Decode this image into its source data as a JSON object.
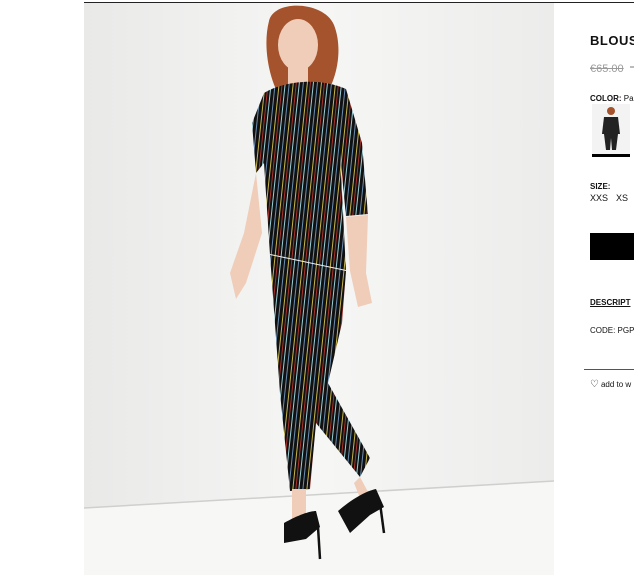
{
  "product": {
    "title": "BLOUS",
    "price": "€65.00",
    "color_label": "COLOR:",
    "color_value": "Pa",
    "size_label": "SIZE:",
    "sizes": [
      "XXS",
      "XS"
    ],
    "description_link": "DESCRIPT",
    "code_text": "CODE: PGP",
    "wishlist_text": "add to w"
  },
  "icons": {
    "wishlist": "heart-outline-icon"
  },
  "colors": {
    "accent": "#000000",
    "muted_price": "#9a9a9a"
  }
}
